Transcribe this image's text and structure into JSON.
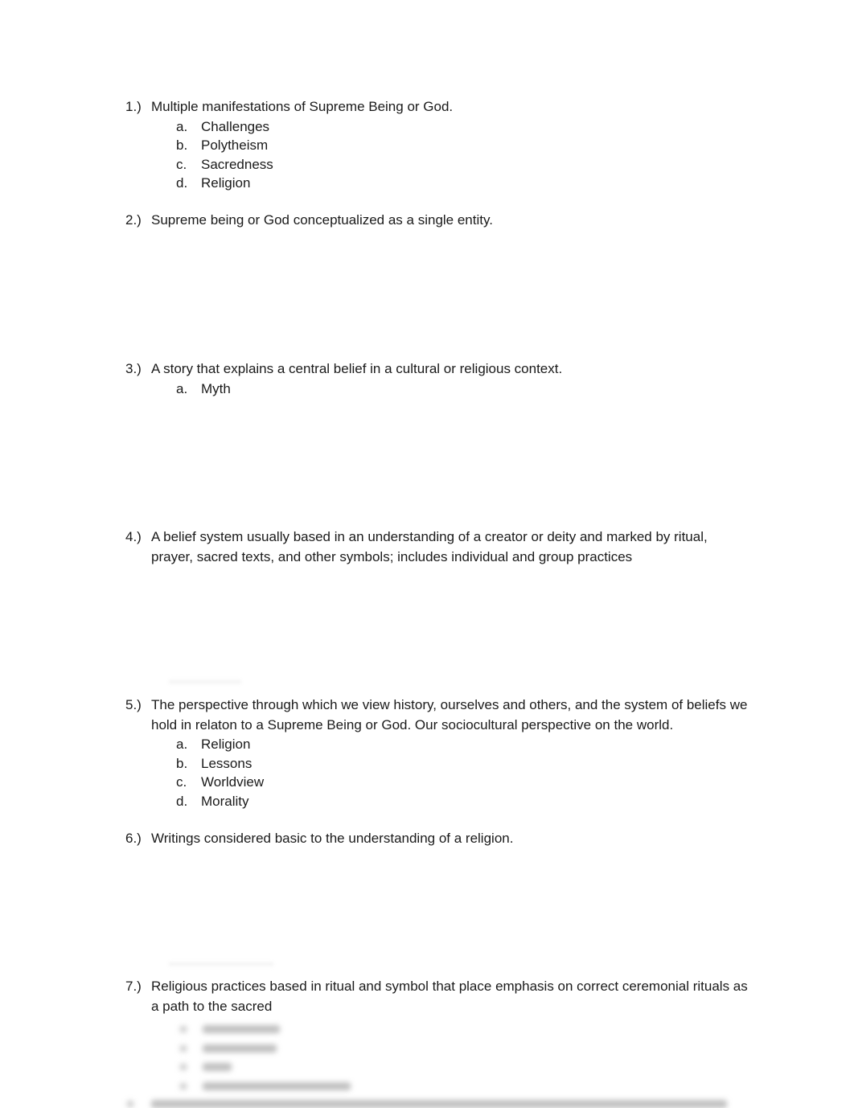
{
  "questions": [
    {
      "number": "1.)",
      "text": "Multiple manifestations of Supreme Being or God.",
      "options": [
        {
          "letter": "a.",
          "text": "Challenges"
        },
        {
          "letter": "b.",
          "text": "Polytheism"
        },
        {
          "letter": "c.",
          "text": "Sacredness"
        },
        {
          "letter": "d.",
          "text": "Religion"
        }
      ]
    },
    {
      "number": "2.)",
      "text": "Supreme being or God conceptualized as a single entity.",
      "options": []
    },
    {
      "number": "3.)",
      "text": "A story that explains a central belief in a cultural or religious context.",
      "options": [
        {
          "letter": "a.",
          "text": "Myth"
        }
      ]
    },
    {
      "number": "4.)",
      "text": "A belief system usually based in an understanding of a creator or deity and marked by ritual, prayer, sacred texts, and other symbols; includes individual and group practices",
      "options": []
    },
    {
      "number": "5.)",
      "text": "The perspective through which we view history, ourselves and others, and the system of beliefs we hold in relaton to a Supreme Being or God. Our sociocultural perspective on the world.",
      "options": [
        {
          "letter": "a.",
          "text": "Religion"
        },
        {
          "letter": "b.",
          "text": "Lessons"
        },
        {
          "letter": "c.",
          "text": "Worldview"
        },
        {
          "letter": "d.",
          "text": "Morality"
        }
      ]
    },
    {
      "number": "6.)",
      "text": "Writings considered basic to the understanding of a religion.",
      "options": []
    },
    {
      "number": "7.)",
      "text": "Religious practices based in ritual and symbol that place emphasis on correct ceremonial rituals as a path to the sacred",
      "options": []
    }
  ],
  "blurred_preview": {
    "note": "content obscured"
  }
}
